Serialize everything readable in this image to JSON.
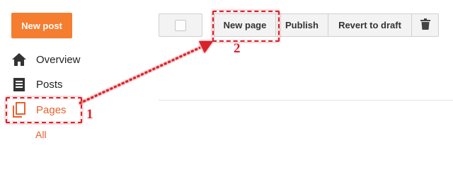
{
  "sidebar": {
    "new_post_label": "New post",
    "items": [
      {
        "label": "Overview",
        "icon": "home-icon"
      },
      {
        "label": "Posts",
        "icon": "document-icon"
      },
      {
        "label": "Pages",
        "icon": "pages-icon",
        "active": true
      }
    ],
    "sub_item": "All"
  },
  "toolbar": {
    "new_page_label": "New page",
    "publish_label": "Publish",
    "revert_label": "Revert to draft",
    "trash_icon": "trash-icon"
  },
  "annotations": {
    "step1": "1",
    "step2": "2"
  },
  "colors": {
    "accent": "#f57d2f",
    "active_text": "#e8612c",
    "annotation": "#d9222a"
  }
}
